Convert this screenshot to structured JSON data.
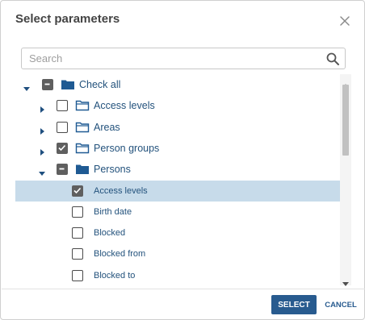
{
  "dialog": {
    "title": "Select parameters",
    "close_icon": "close-icon"
  },
  "search": {
    "placeholder": "Search",
    "value": "",
    "icon": "search-icon"
  },
  "tree": {
    "items": [
      {
        "label": "Check all",
        "level": 0,
        "expander": "expanded",
        "check": "partial",
        "folder": true
      },
      {
        "label": "Access levels",
        "level": 1,
        "expander": "collapsed",
        "check": "unchecked",
        "folder": true
      },
      {
        "label": "Areas",
        "level": 1,
        "expander": "collapsed",
        "check": "unchecked",
        "folder": true
      },
      {
        "label": "Person groups",
        "level": 1,
        "expander": "collapsed",
        "check": "checked",
        "folder": true
      },
      {
        "label": "Persons",
        "level": 1,
        "expander": "expanded",
        "check": "partial",
        "folder": true
      },
      {
        "label": "Access levels",
        "level": 2,
        "expander": "none",
        "check": "checked",
        "folder": false,
        "selected": true
      },
      {
        "label": "Birth date",
        "level": 2,
        "expander": "none",
        "check": "unchecked",
        "folder": false
      },
      {
        "label": "Blocked",
        "level": 2,
        "expander": "none",
        "check": "unchecked",
        "folder": false
      },
      {
        "label": "Blocked from",
        "level": 2,
        "expander": "none",
        "check": "unchecked",
        "folder": false
      },
      {
        "label": "Blocked to",
        "level": 2,
        "expander": "none",
        "check": "unchecked",
        "folder": false
      }
    ]
  },
  "footer": {
    "select_label": "SELECT",
    "cancel_label": "CANCEL"
  },
  "colors": {
    "primary": "#285b8f",
    "selected_row": "#c7dbea",
    "label": "#23527c",
    "folder": "#1f5a93",
    "checkbox_fill": "#5f5f5f"
  }
}
